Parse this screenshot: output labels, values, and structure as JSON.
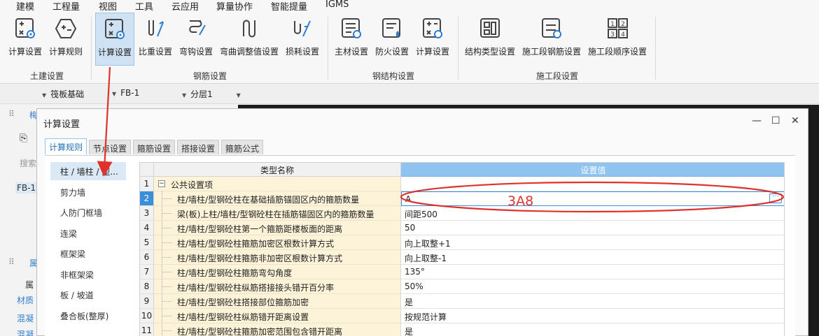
{
  "menu": [
    "建模",
    "工程量",
    "视图",
    "工具",
    "云应用",
    "算量协作",
    "智能提量",
    "IGMS"
  ],
  "ribbon": {
    "groups": [
      {
        "label": "土建设置",
        "buttons": [
          "计算设置",
          "计算规则"
        ]
      },
      {
        "label": "钢筋设置",
        "buttons": [
          "计算设置",
          "比重设置",
          "弯钩设置",
          "弯曲调整值设置",
          "损耗设置"
        ]
      },
      {
        "label": "钢结构设置",
        "buttons": [
          "主材设置",
          "防火设置",
          "计算设置"
        ]
      },
      {
        "label": "施工段设置",
        "buttons": [
          "结构类型设置",
          "施工段钢筋设置",
          "施工段顺序设置"
        ]
      }
    ]
  },
  "selectors": [
    "筏板基础",
    "FB-1",
    "分层1"
  ],
  "background": {
    "panel_labels": [
      "梅",
      "搜索",
      "FB-1",
      "属",
      "属",
      "材质",
      "混凝",
      "混凝"
    ]
  },
  "dialog": {
    "title": "计算设置",
    "window_controls": {
      "minimize": "—",
      "maximize": "☐",
      "close": "✕"
    },
    "tabs": [
      "计算规则",
      "节点设置",
      "箍筋设置",
      "搭接设置",
      "箍筋公式"
    ],
    "active_tab": 0,
    "categories": [
      "柱 / 墙柱 / 型...",
      "剪力墙",
      "人防门框墙",
      "连梁",
      "框架梁",
      "非框架梁",
      "板 / 坡道",
      "叠合板(整厚)"
    ],
    "selected_category": 0,
    "grid": {
      "header_name": "类型名称",
      "header_value": "设置值",
      "rows": [
        {
          "num": "1",
          "name": "公共设置项",
          "value": "",
          "group": true
        },
        {
          "num": "2",
          "name": "柱/墙柱/型钢砼柱在基础插筋锚固区内的箍筋数量",
          "value": "A"
        },
        {
          "num": "3",
          "name": "梁(板)上柱/墙柱/型钢砼柱在插筋锚固区内的箍筋数量",
          "value": "间距500"
        },
        {
          "num": "4",
          "name": "柱/墙柱/型钢砼柱第一个箍筋距楼板面的距离",
          "value": "50"
        },
        {
          "num": "5",
          "name": "柱/墙柱/型钢砼柱箍筋加密区根数计算方式",
          "value": "向上取整+1"
        },
        {
          "num": "6",
          "name": "柱/墙柱/型钢砼柱箍筋非加密区根数计算方式",
          "value": "向上取整-1"
        },
        {
          "num": "7",
          "name": "柱/墙柱/型钢砼柱箍筋弯勾角度",
          "value": "135°"
        },
        {
          "num": "8",
          "name": "柱/墙柱/型钢砼柱纵筋搭接接头错开百分率",
          "value": "50%"
        },
        {
          "num": "9",
          "name": "柱/墙柱/型钢砼柱搭接部位箍筋加密",
          "value": "是"
        },
        {
          "num": "10",
          "name": "柱/墙柱/型钢砼柱纵筋错开距离设置",
          "value": "按规范计算"
        },
        {
          "num": "11",
          "name": "柱/墙柱/型钢砼柱箍筋加密范围包含错开距离",
          "value": "是"
        }
      ],
      "selected_row": 1,
      "ellipsis": "···"
    }
  },
  "annotation": {
    "text": "3A8",
    "color": "#e0322a"
  },
  "colors": {
    "accent": "#3c8fd6",
    "header_value_bg": "#8fc3f0",
    "name_cell_bg": "#fdf3d8",
    "active_button_bg": "#cfe2f3"
  }
}
